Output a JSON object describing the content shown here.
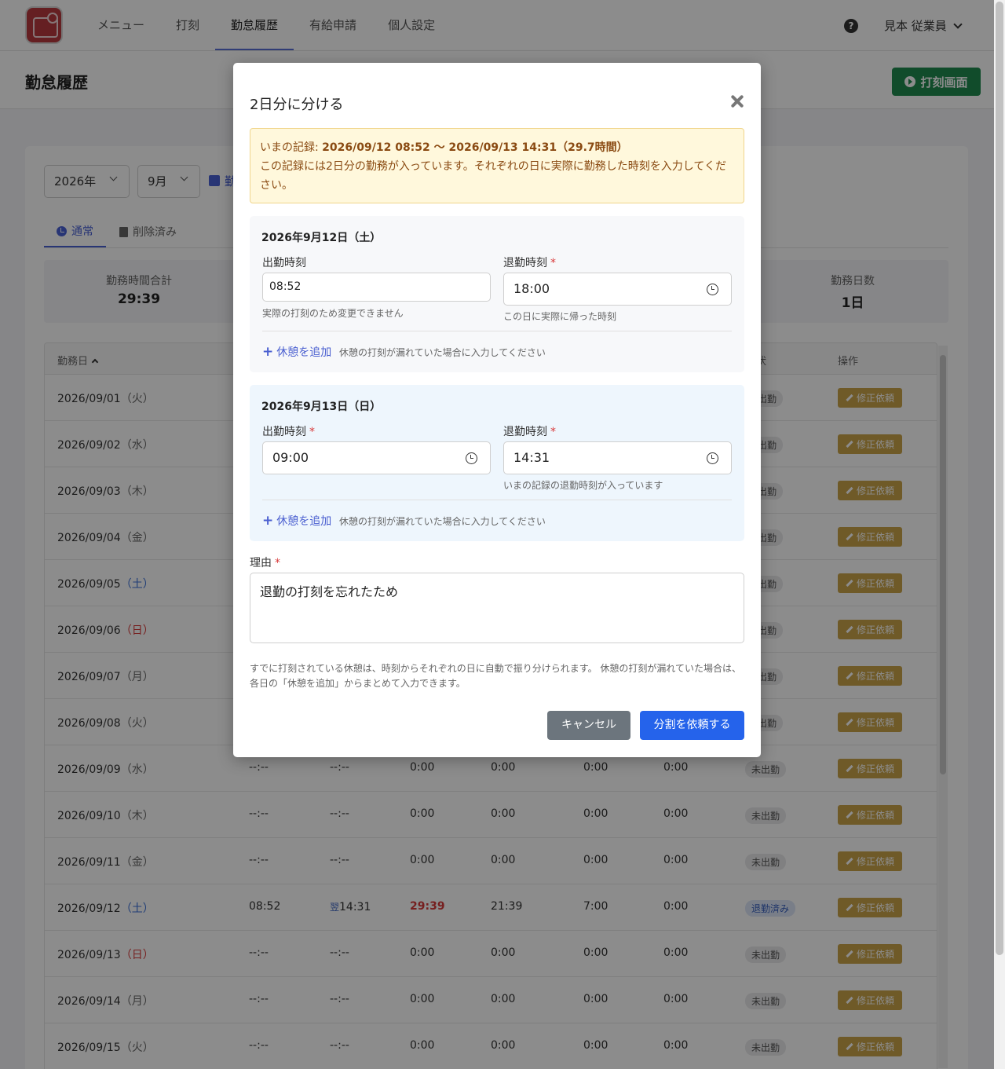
{
  "nav": {
    "items": [
      "メニュー",
      "打刻",
      "勤怠履歴",
      "有給申請",
      "個人設定"
    ],
    "user": "見本 従業員"
  },
  "page": {
    "title": "勤怠履歴",
    "punch_button": "打刻画面"
  },
  "filters": {
    "year": "2026年",
    "month": "9月",
    "print_label": "勤"
  },
  "tabs": [
    "通常",
    "削除済み"
  ],
  "stats": {
    "work_total_label": "勤務時間合計",
    "work_total_value": "29:39",
    "work_days_label": "勤務日数",
    "work_days_value": "1日"
  },
  "table": {
    "col_date": "勤務日",
    "col_status": "状",
    "col_ops": "操作",
    "fix_label": "修正依頼",
    "rows": [
      {
        "date": "2026/09/01",
        "dow": "（火）",
        "status": "出勤"
      },
      {
        "date": "2026/09/02",
        "dow": "（水）",
        "status": "出勤"
      },
      {
        "date": "2026/09/03",
        "dow": "（木）",
        "status": "出勤"
      },
      {
        "date": "2026/09/04",
        "dow": "（金）",
        "status": "出勤"
      },
      {
        "date": "2026/09/05",
        "dow": "（土）",
        "status": "出勤"
      },
      {
        "date": "2026/09/06",
        "dow": "（日）",
        "status": "出勤"
      },
      {
        "date": "2026/09/07",
        "dow": "（月）",
        "status": "出勤"
      },
      {
        "date": "2026/09/08",
        "dow": "（火）",
        "status": "出勤"
      },
      {
        "date": "2026/09/09",
        "dow": "（水）",
        "in": "--:--",
        "out": "--:--",
        "c1": "0:00",
        "c2": "0:00",
        "c3": "0:00",
        "c4": "0:00",
        "status": "未出勤"
      },
      {
        "date": "2026/09/10",
        "dow": "（木）",
        "in": "--:--",
        "out": "--:--",
        "c1": "0:00",
        "c2": "0:00",
        "c3": "0:00",
        "c4": "0:00",
        "status": "未出勤"
      },
      {
        "date": "2026/09/11",
        "dow": "（金）",
        "in": "--:--",
        "out": "--:--",
        "c1": "0:00",
        "c2": "0:00",
        "c3": "0:00",
        "c4": "0:00",
        "status": "未出勤"
      },
      {
        "date": "2026/09/12",
        "dow": "（土）",
        "in": "08:52",
        "out_prefix": "翌",
        "out": "14:31",
        "c1": "29:39",
        "c2": "21:39",
        "c3": "7:00",
        "c4": "0:00",
        "status": "退勤済み"
      },
      {
        "date": "2026/09/13",
        "dow": "（日）",
        "in": "--:--",
        "out": "--:--",
        "c1": "0:00",
        "c2": "0:00",
        "c3": "0:00",
        "c4": "0:00",
        "status": "未出勤"
      },
      {
        "date": "2026/09/14",
        "dow": "（月）",
        "in": "--:--",
        "out": "--:--",
        "c1": "0:00",
        "c2": "0:00",
        "c3": "0:00",
        "c4": "0:00",
        "status": "未出勤"
      },
      {
        "date": "2026/09/15",
        "dow": "（火）",
        "in": "--:--",
        "out": "--:--",
        "c1": "0:00",
        "c2": "0:00",
        "c3": "0:00",
        "c4": "0:00",
        "status": "未出勤"
      }
    ]
  },
  "modal": {
    "title": "2日分に分ける",
    "alert_prefix": "いまの記録: ",
    "alert_record": "2026/09/12 08:52 〜 2026/09/13 14:31（29.7時間）",
    "alert_text": "この記録には2日分の勤務が入っています。それぞれの日に実際に勤務した時刻を入力してください。",
    "day1": {
      "title": "2026年9月12日（土）",
      "in_label": "出勤時刻",
      "in_value": "08:52",
      "in_hint": "実際の打刻のため変更できません",
      "out_label": "退勤時刻",
      "out_value": "18:00",
      "out_hint": "この日に実際に帰った時刻"
    },
    "day2": {
      "title": "2026年9月13日（日）",
      "in_label": "出勤時刻",
      "in_value": "09:00",
      "out_label": "退勤時刻",
      "out_value": "14:31",
      "out_hint": "いまの記録の退勤時刻が入っています"
    },
    "add_break": "休憩を追加",
    "add_break_hint": "休憩の打刻が漏れていた場合に入力してください",
    "required_mark": "*",
    "reason_label": "理由",
    "reason_value": "退勤の打刻を忘れたため",
    "note": "すでに打刻されている休憩は、時刻からそれぞれの日に自動で振り分けられます。 休憩の打刻が漏れていた場合は、各日の「休憩を追加」からまとめて入力できます。",
    "cancel": "キャンセル",
    "submit": "分割を依頼する"
  }
}
